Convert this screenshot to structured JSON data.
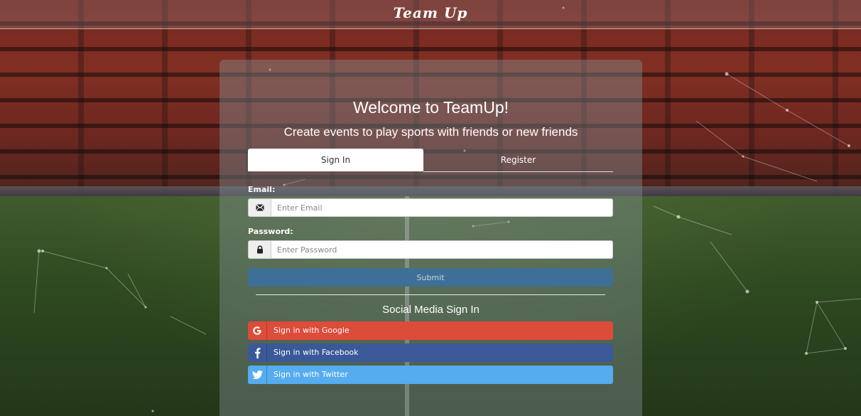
{
  "brand": {
    "title": "Team Up"
  },
  "hero": {
    "title": "Welcome to TeamUp!",
    "subtitle": "Create events to play sports with friends or new friends"
  },
  "tabs": [
    {
      "label": "Sign In",
      "active": true
    },
    {
      "label": "Register",
      "active": false
    }
  ],
  "form": {
    "email_label": "Email:",
    "email_placeholder": "Enter Email",
    "email_icon": "envelope-icon",
    "password_label": "Password:",
    "password_placeholder": "Enter Password",
    "password_icon": "lock-icon",
    "submit_label": "Submit"
  },
  "social": {
    "title": "Social Media Sign In",
    "buttons": [
      {
        "label": "Sign in with Google",
        "icon": "google-icon",
        "color": "#dd4b39"
      },
      {
        "label": "Sign in with Facebook",
        "icon": "facebook-icon",
        "color": "#3b5998"
      },
      {
        "label": "Sign in with Twitter",
        "icon": "twitter-icon",
        "color": "#55acee"
      }
    ]
  },
  "colors": {
    "submit": "#3e6f96",
    "panel": "rgba(130,145,150,0.42)"
  }
}
